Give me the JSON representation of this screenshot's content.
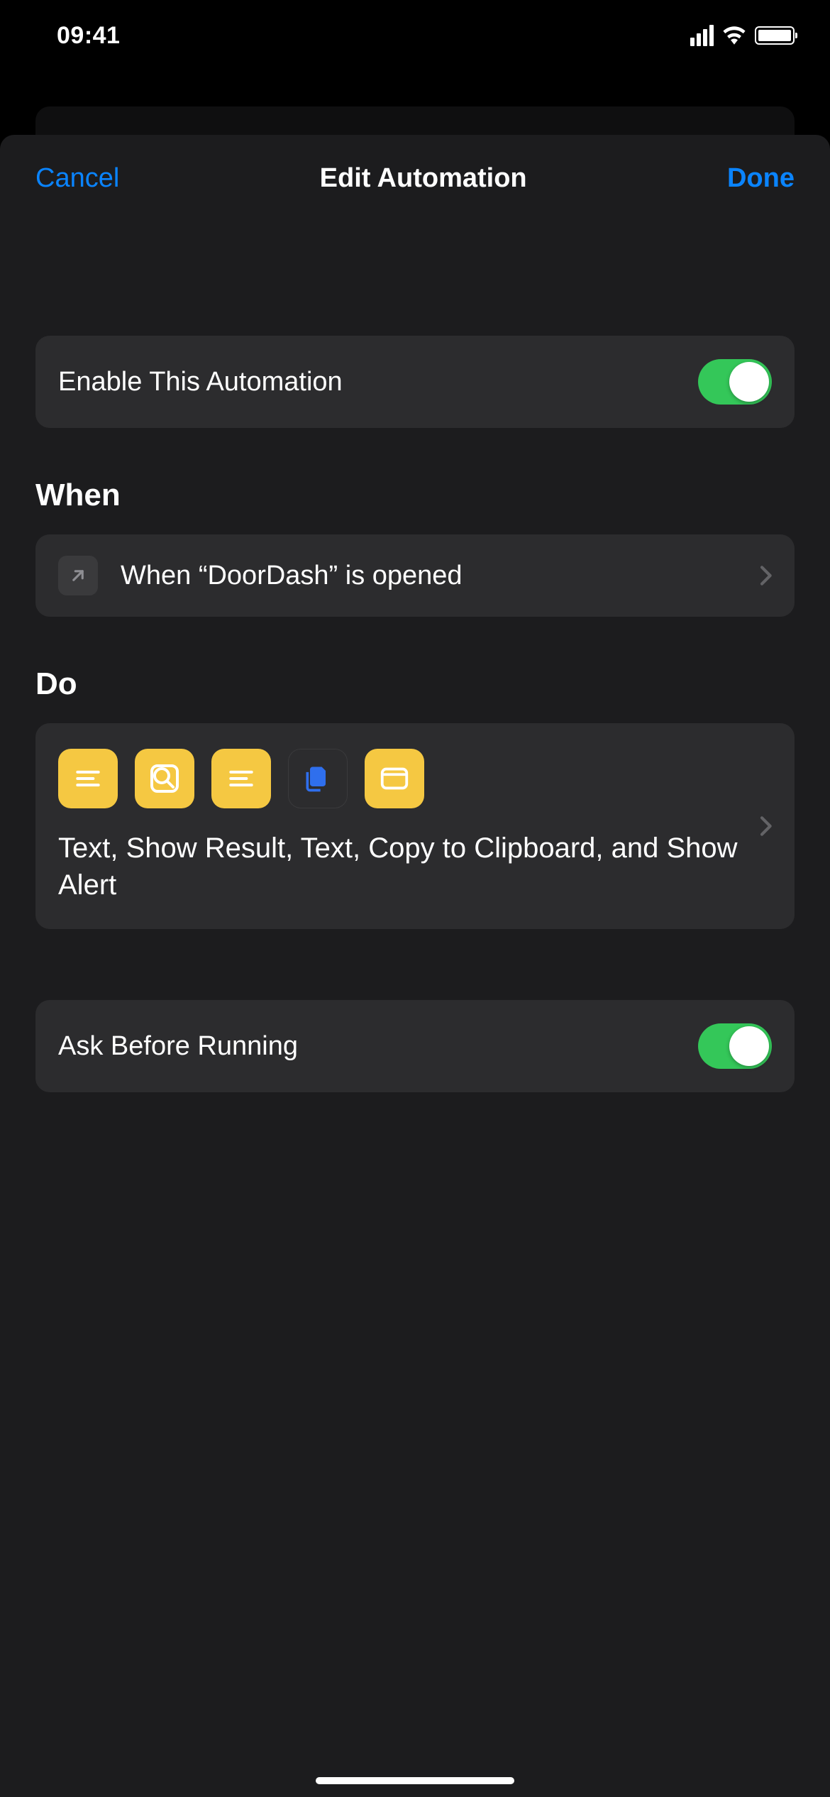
{
  "status": {
    "time": "09:41"
  },
  "nav": {
    "cancel": "Cancel",
    "title": "Edit Automation",
    "done": "Done"
  },
  "enable": {
    "label": "Enable This Automation",
    "on": true
  },
  "sections": {
    "when": "When",
    "do": "Do"
  },
  "trigger": {
    "text": "When “DoorDash” is opened",
    "icon": "open-app-icon"
  },
  "actions": {
    "icons": [
      {
        "type": "text",
        "color": "yellow"
      },
      {
        "type": "show-result",
        "color": "yellow"
      },
      {
        "type": "text",
        "color": "yellow"
      },
      {
        "type": "copy-clipboard",
        "color": "dark"
      },
      {
        "type": "show-alert",
        "color": "yellow"
      }
    ],
    "summary": "Text, Show Result, Text, Copy to Clipboard, and Show Alert"
  },
  "ask": {
    "label": "Ask Before Running",
    "on": true
  }
}
